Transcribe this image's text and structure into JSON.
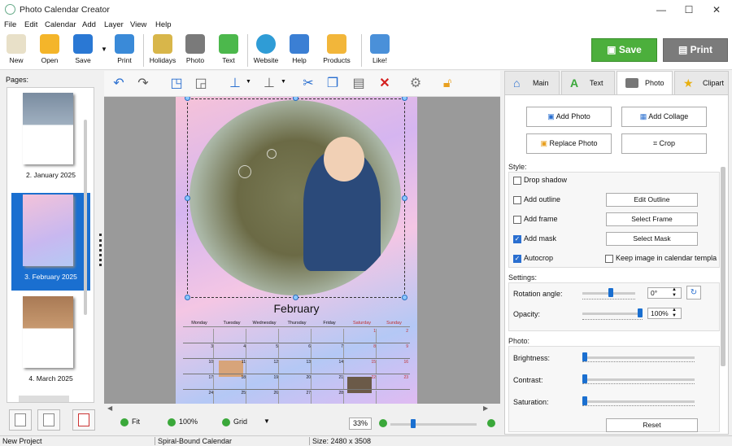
{
  "app": {
    "title": "Photo Calendar Creator"
  },
  "window_controls": {
    "minimize": "—",
    "maximize": "☐",
    "close": "✕"
  },
  "menu": [
    "File",
    "Edit",
    "Calendar",
    "Add",
    "Layer",
    "View",
    "Help"
  ],
  "toolbar": {
    "buttons": [
      {
        "label": "New",
        "icon": "new-document-icon"
      },
      {
        "label": "Open",
        "icon": "folder-icon"
      },
      {
        "label": "Save",
        "icon": "floppy-disk-icon"
      },
      {
        "label": "Print",
        "icon": "printer-icon"
      },
      {
        "label": "Holidays",
        "icon": "calendar-icon"
      },
      {
        "label": "Photo",
        "icon": "camera-icon"
      },
      {
        "label": "Text",
        "icon": "text-a-icon"
      },
      {
        "label": "Website",
        "icon": "globe-icon"
      },
      {
        "label": "Help",
        "icon": "book-icon"
      },
      {
        "label": "Products",
        "icon": "box-icon"
      },
      {
        "label": "Like!",
        "icon": "thumbs-up-icon"
      }
    ],
    "save_big": "Save",
    "print_big": "Print",
    "colors": {
      "save": "#4caf3c",
      "print": "#7b7b7b"
    }
  },
  "pages_panel": {
    "label": "Pages:",
    "pages": [
      {
        "label": "2. January 2025",
        "selected": false
      },
      {
        "label": "3. February 2025",
        "selected": true
      },
      {
        "label": "4. March 2025",
        "selected": false
      }
    ]
  },
  "edit_toolbar": {
    "icons": [
      "undo-icon",
      "redo-icon",
      "bring-front-icon",
      "send-back-icon",
      "align-icon",
      "distribute-icon",
      "cut-icon",
      "copy-icon",
      "paste-icon",
      "delete-icon",
      "settings-icon",
      "lock-icon"
    ]
  },
  "calendar": {
    "month": "February",
    "weekdays": [
      "Monday",
      "Tuesday",
      "Wednesday",
      "Thursday",
      "Friday",
      "Saturday",
      "Sunday"
    ],
    "weeks": [
      [
        "",
        "",
        "",
        "",
        "",
        "1",
        "2"
      ],
      [
        "3",
        "4",
        "5",
        "6",
        "7",
        "8",
        "9"
      ],
      [
        "10",
        "11",
        "12",
        "13",
        "14",
        "15",
        "16"
      ],
      [
        "17",
        "18",
        "19",
        "20",
        "21",
        "22",
        "23"
      ],
      [
        "24",
        "25",
        "26",
        "27",
        "28",
        "",
        ""
      ]
    ]
  },
  "bottom_bar": {
    "fit": "Fit",
    "zoom100": "100%",
    "grid": "Grid",
    "zoom": "33%"
  },
  "right_panel": {
    "tabs": [
      {
        "label": "Main",
        "icon": "house-icon",
        "active": false
      },
      {
        "label": "Text",
        "icon": "text-a-icon",
        "active": false
      },
      {
        "label": "Photo",
        "icon": "camera-icon",
        "active": true
      },
      {
        "label": "Clipart",
        "icon": "star-icon",
        "active": false
      }
    ],
    "buttons": {
      "add_photo": "Add Photo",
      "add_collage": "Add Collage",
      "replace_photo": "Replace Photo",
      "crop": "Crop"
    },
    "style": {
      "label": "Style:",
      "drop_shadow": {
        "label": "Drop shadow",
        "checked": false
      },
      "add_outline": {
        "label": "Add outline",
        "checked": false
      },
      "add_frame": {
        "label": "Add frame",
        "checked": false
      },
      "add_mask": {
        "label": "Add mask",
        "checked": true
      },
      "autocrop": {
        "label": "Autocrop",
        "checked": true
      },
      "keep_image": {
        "label": "Keep image in calendar templa",
        "checked": false
      },
      "edit_outline": "Edit Outline",
      "select_frame": "Select Frame",
      "select_mask": "Select Mask"
    },
    "settings": {
      "label": "Settings:",
      "rotation_label": "Rotation angle:",
      "rotation_value": "0°",
      "opacity_label": "Opacity:",
      "opacity_value": "100%",
      "rotation_fraction": 0.5,
      "opacity_fraction": 1.0
    },
    "photo": {
      "label": "Photo:",
      "brightness": "Brightness:",
      "contrast": "Contrast:",
      "saturation": "Saturation:",
      "reset": "Reset"
    }
  },
  "status": {
    "project": "New Project",
    "type": "Spiral-Bound Calendar",
    "size": "Size: 2480 x 3508"
  }
}
